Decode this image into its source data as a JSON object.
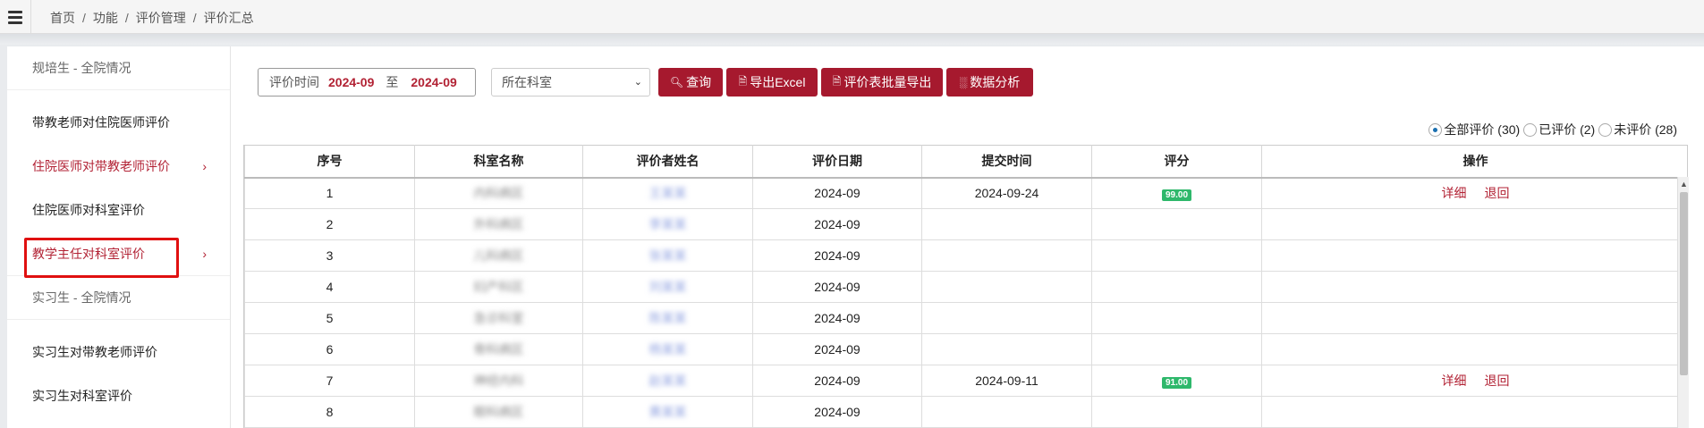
{
  "breadcrumb": [
    "首页",
    "功能",
    "评价管理",
    "评价汇总"
  ],
  "sidebar": {
    "group1": "规培生 - 全院情况",
    "items1": [
      {
        "label": "带教老师对住院医师评价"
      },
      {
        "label": "住院医师对带教老师评价",
        "chevron": "›"
      },
      {
        "label": "住院医师对科室评价"
      },
      {
        "label": "教学主任对科室评价",
        "chevron": "›"
      }
    ],
    "group2": "实习生 - 全院情况",
    "items2": [
      {
        "label": "实习生对带教老师评价"
      },
      {
        "label": "实习生对科室评价"
      }
    ]
  },
  "filter": {
    "date_label": "评价时间",
    "date_from": "2024-09",
    "date_to_label": "至",
    "date_to": "2024-09",
    "dept_select": "所在科室"
  },
  "buttons": {
    "query": "查询",
    "export_excel": "导出Excel",
    "batch_export": "评价表批量导出",
    "analysis": "数据分析"
  },
  "radios": [
    {
      "label": "全部评价 (30)",
      "checked": true
    },
    {
      "label": "已评价 (2)",
      "checked": false
    },
    {
      "label": "未评价 (28)",
      "checked": false
    }
  ],
  "table": {
    "headers": [
      "序号",
      "科室名称",
      "评价者姓名",
      "评价日期",
      "提交时间",
      "评分",
      "操作"
    ],
    "rows": [
      {
        "no": "1",
        "dept": "内科病区",
        "name": "王某某",
        "date": "2024-09",
        "submit": "2024-09-24",
        "score": "99.00",
        "ops": [
          "详细",
          "退回"
        ]
      },
      {
        "no": "2",
        "dept": "外科病区",
        "name": "李某某",
        "date": "2024-09",
        "submit": "",
        "score": "",
        "ops": []
      },
      {
        "no": "3",
        "dept": "儿科病区",
        "name": "张某某",
        "date": "2024-09",
        "submit": "",
        "score": "",
        "ops": []
      },
      {
        "no": "4",
        "dept": "妇产科区",
        "name": "刘某某",
        "date": "2024-09",
        "submit": "",
        "score": "",
        "ops": []
      },
      {
        "no": "5",
        "dept": "急诊科室",
        "name": "陈某某",
        "date": "2024-09",
        "submit": "",
        "score": "",
        "ops": []
      },
      {
        "no": "6",
        "dept": "骨科病区",
        "name": "杨某某",
        "date": "2024-09",
        "submit": "",
        "score": "",
        "ops": []
      },
      {
        "no": "7",
        "dept": "神经内科",
        "name": "赵某某",
        "date": "2024-09",
        "submit": "2024-09-11",
        "score": "91.00",
        "ops": [
          "详细",
          "退回"
        ]
      },
      {
        "no": "8",
        "dept": "眼科病区",
        "name": "黄某某",
        "date": "2024-09",
        "submit": "",
        "score": "",
        "ops": []
      }
    ]
  },
  "colors": {
    "accent": "#a6192e",
    "link": "#b22234",
    "score_bg": "#2eb86b",
    "highlight_box": "#e01010"
  },
  "icons": {
    "menu": "hamburger-icon",
    "query": "search-icon",
    "export": "file-icon",
    "analysis": "bar-chart-icon"
  }
}
